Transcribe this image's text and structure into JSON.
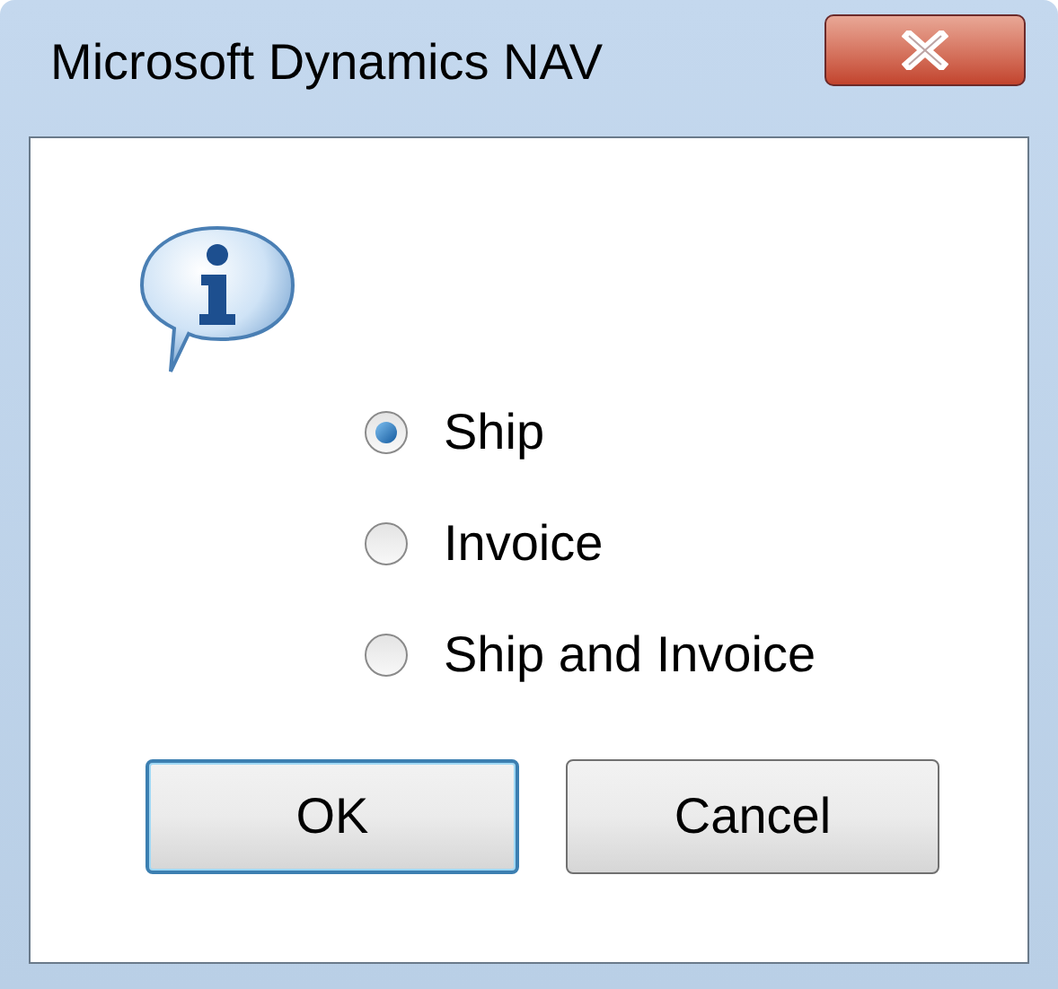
{
  "window": {
    "title": "Microsoft Dynamics NAV"
  },
  "options": [
    {
      "label": "Ship",
      "selected": true
    },
    {
      "label": "Invoice",
      "selected": false
    },
    {
      "label": "Ship and Invoice",
      "selected": false
    }
  ],
  "buttons": [
    {
      "label": "OK",
      "kind": "default"
    },
    {
      "label": "Cancel",
      "kind": "normal"
    }
  ]
}
